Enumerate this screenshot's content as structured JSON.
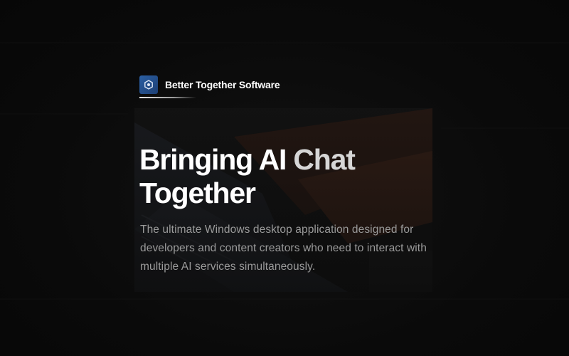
{
  "brand": {
    "name": "Better Together Software",
    "logo_icon": "hexagon-logo-icon",
    "logo_color": "#2b5fa3"
  },
  "hero": {
    "headline_line1_a": "Bringing AI ",
    "headline_line1_b": "Chat",
    "headline_line2": "Together",
    "description": "The ultimate Windows desktop application designed for developers and content creators who need to interact with multiple AI services simultaneously."
  },
  "colors": {
    "background": "#0b0b0b",
    "headline": "#ffffff",
    "body_text": "#9a9a9a"
  }
}
